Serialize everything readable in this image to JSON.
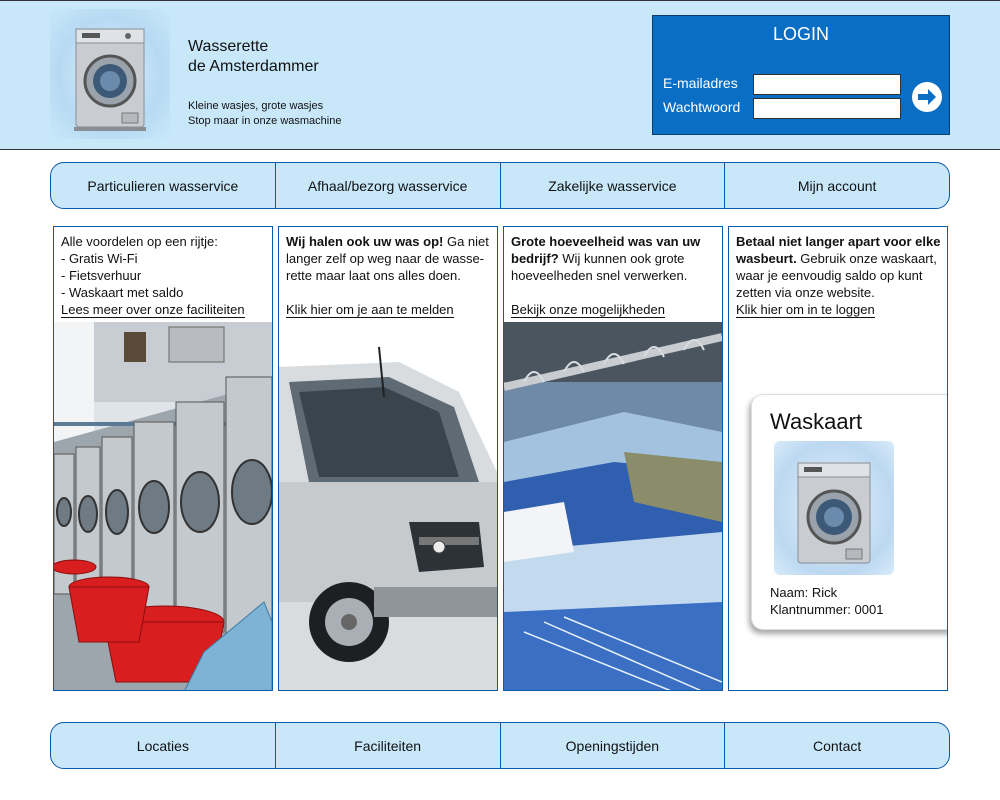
{
  "header": {
    "brand_line1": "Wasserette",
    "brand_line2": "de Amsterdammer",
    "tagline_line1": "Kleine wasjes, grote wasjes",
    "tagline_line2": "Stop maar in onze wasmachine",
    "logo_icon": "washing-machine-icon"
  },
  "login": {
    "title": "LOGIN",
    "email_label": "E-mailadres",
    "password_label": "Wachtwoord",
    "email_value": "",
    "password_value": "",
    "submit_icon": "arrow-right-icon"
  },
  "top_nav": [
    {
      "label": "Particulieren wasservice"
    },
    {
      "label": "Afhaal/bezorg wasservice"
    },
    {
      "label": "Zakelijke wasservice"
    },
    {
      "label": "Mijn account"
    }
  ],
  "columns": [
    {
      "lines": [
        "Alle voordelen op een rijtje:",
        "- Gratis Wi-Fi",
        "- Fietsverhuur",
        "- Waskaart met saldo"
      ],
      "link": "Lees meer over onze faciliteiten",
      "image": "laundromat-photo"
    },
    {
      "bold": "Wij halen ook uw was op!",
      "text": " Ga niet langer zelf op weg naar de wasse-rette maar laat ons alles doen.",
      "link": "Klik hier om je aan te melden",
      "image": "delivery-van-photo"
    },
    {
      "bold": "Grote hoeveelheid was van uw bedrijf?",
      "text": " Wij kunnen ook grote hoeveelheden snel verwerken.",
      "link": "Bekijk onze mogelijkheden",
      "image": "shirts-rack-photo"
    },
    {
      "bold": "Betaal niet langer apart voor elke wasbeurt.",
      "text": " Gebruik onze waskaart, waar je eenvoudig saldo op kunt zetten via onze website.",
      "link": "Klik hier om in te loggen"
    }
  ],
  "waskaart": {
    "title": "Waskaart",
    "name": "Naam: Rick",
    "customer_number": "Klantnummer: 0001",
    "image": "washing-machine-icon"
  },
  "bottom_nav": [
    {
      "label": "Locaties"
    },
    {
      "label": "Faciliteiten"
    },
    {
      "label": "Openingstijden"
    },
    {
      "label": "Contact"
    }
  ],
  "colors": {
    "header_bg": "#c8e8fa",
    "login_bg": "#0a6fc4",
    "border_blue": "#0b5aa8"
  }
}
